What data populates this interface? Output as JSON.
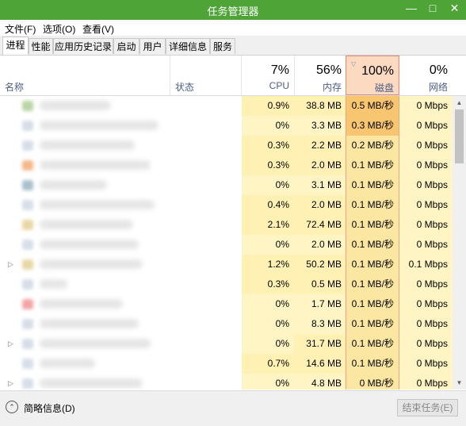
{
  "window": {
    "title": "任务管理器",
    "min": "—",
    "max": "□",
    "close": "✕"
  },
  "menu": [
    "文件(F)",
    "选项(O)",
    "查看(V)"
  ],
  "tabs": [
    "进程",
    "性能",
    "应用历史记录",
    "启动",
    "用户",
    "详细信息",
    "服务"
  ],
  "columns": {
    "name": "名称",
    "status": "状态",
    "cpu": {
      "pct": "7%",
      "label": "CPU"
    },
    "mem": {
      "pct": "56%",
      "label": "内存"
    },
    "disk": {
      "pct": "100%",
      "label": "磁盘"
    },
    "net": {
      "pct": "0%",
      "label": "网络"
    }
  },
  "rows": [
    {
      "expand": "",
      "cpu": "0.9%",
      "mem": "38.8 MB",
      "disk": "0.5 MB/秒",
      "net": "0 Mbps"
    },
    {
      "expand": "",
      "cpu": "0%",
      "mem": "3.3 MB",
      "disk": "0.3 MB/秒",
      "net": "0 Mbps"
    },
    {
      "expand": "",
      "cpu": "0.3%",
      "mem": "2.2 MB",
      "disk": "0.2 MB/秒",
      "net": "0 Mbps"
    },
    {
      "expand": "",
      "cpu": "0.3%",
      "mem": "2.0 MB",
      "disk": "0.1 MB/秒",
      "net": "0 Mbps"
    },
    {
      "expand": "",
      "cpu": "0%",
      "mem": "3.1 MB",
      "disk": "0.1 MB/秒",
      "net": "0 Mbps"
    },
    {
      "expand": "",
      "cpu": "0.4%",
      "mem": "2.0 MB",
      "disk": "0.1 MB/秒",
      "net": "0 Mbps"
    },
    {
      "expand": "",
      "cpu": "2.1%",
      "mem": "72.4 MB",
      "disk": "0.1 MB/秒",
      "net": "0 Mbps"
    },
    {
      "expand": "",
      "cpu": "0%",
      "mem": "2.0 MB",
      "disk": "0.1 MB/秒",
      "net": "0 Mbps"
    },
    {
      "expand": "▷",
      "cpu": "1.2%",
      "mem": "50.2 MB",
      "disk": "0.1 MB/秒",
      "net": "0.1 Mbps"
    },
    {
      "expand": "",
      "cpu": "0.3%",
      "mem": "0.5 MB",
      "disk": "0.1 MB/秒",
      "net": "0 Mbps"
    },
    {
      "expand": "",
      "cpu": "0%",
      "mem": "1.7 MB",
      "disk": "0.1 MB/秒",
      "net": "0 Mbps"
    },
    {
      "expand": "",
      "cpu": "0%",
      "mem": "8.3 MB",
      "disk": "0.1 MB/秒",
      "net": "0 Mbps"
    },
    {
      "expand": "▷",
      "cpu": "0%",
      "mem": "31.7 MB",
      "disk": "0.1 MB/秒",
      "net": "0 Mbps"
    },
    {
      "expand": "",
      "cpu": "0.7%",
      "mem": "14.6 MB",
      "disk": "0.1 MB/秒",
      "net": "0 Mbps"
    },
    {
      "expand": "▷",
      "cpu": "0%",
      "mem": "4.8 MB",
      "disk": "0 MB/秒",
      "net": "0 Mbps"
    }
  ],
  "footer": {
    "collapse_icon": "⌃",
    "brief": "简略信息(D)",
    "end_task": "结束任务(E)"
  },
  "scrollbar": {
    "up": "▲",
    "down": "▼"
  }
}
